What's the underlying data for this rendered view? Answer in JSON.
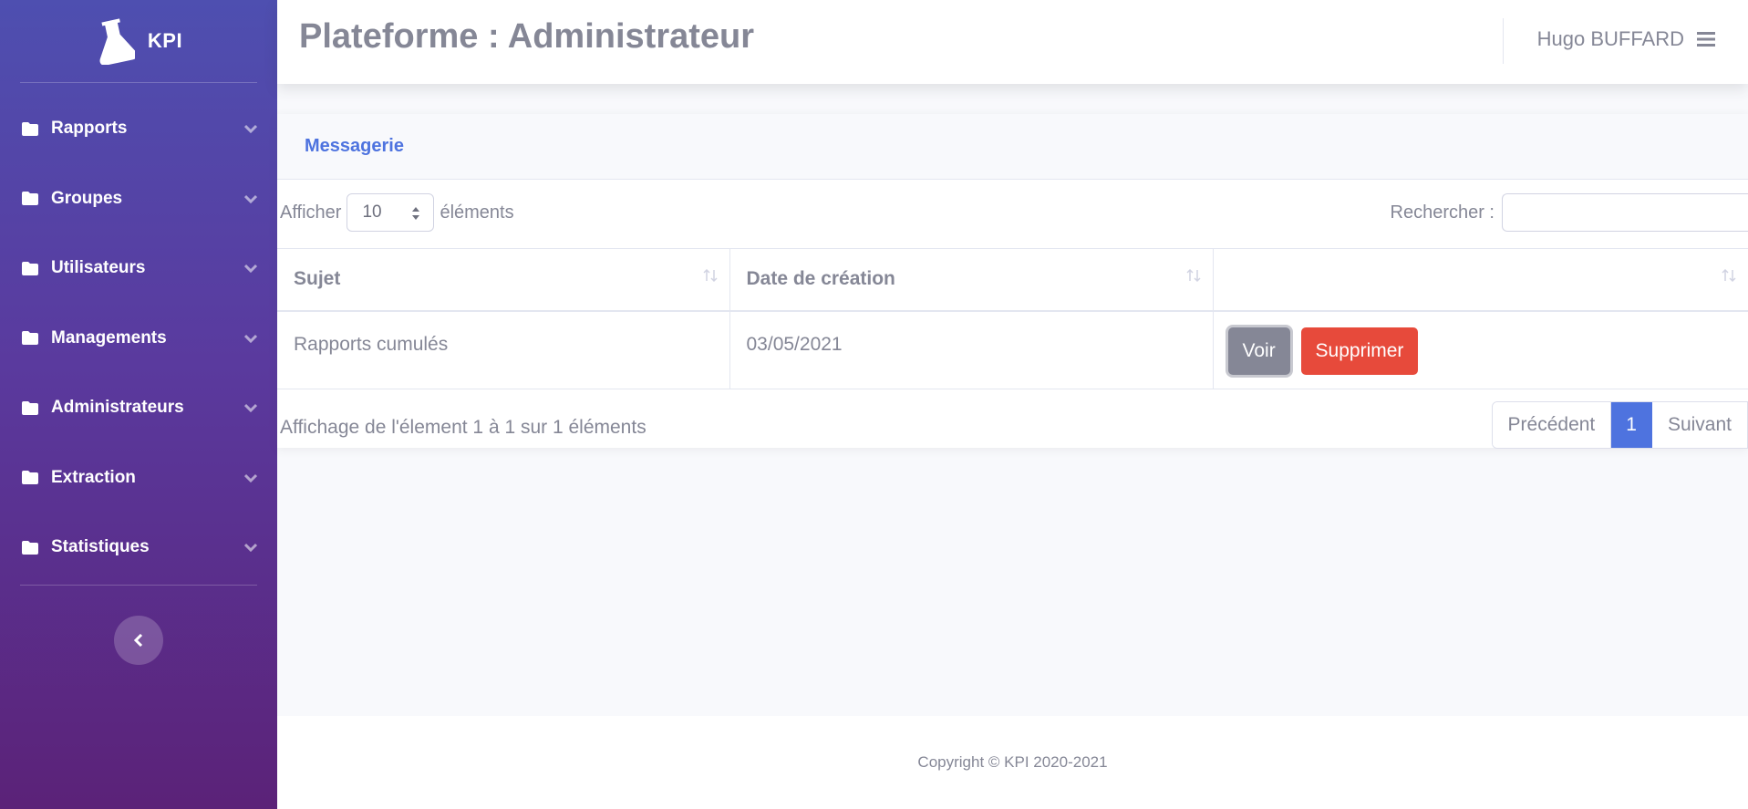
{
  "brand": {
    "name": "KPI",
    "icon": "flask-icon"
  },
  "sidebar": {
    "items": [
      {
        "label": "Rapports",
        "icon": "folder-icon"
      },
      {
        "label": "Groupes",
        "icon": "folder-icon"
      },
      {
        "label": "Utilisateurs",
        "icon": "folder-icon"
      },
      {
        "label": "Managements",
        "icon": "folder-icon"
      },
      {
        "label": "Administrateurs",
        "icon": "folder-icon"
      },
      {
        "label": "Extraction",
        "icon": "folder-icon"
      },
      {
        "label": "Statistiques",
        "icon": "folder-icon"
      }
    ],
    "toggle_icon": "chevron-left-icon",
    "gradient": [
      "#4e4fb0",
      "#5b2278"
    ]
  },
  "header": {
    "title_bold": "Plateforme :",
    "title_rest": "Administrateur",
    "user_name": "Hugo BUFFARD",
    "menu_icon": "hamburger-icon"
  },
  "card": {
    "title": "Messagerie",
    "length": {
      "prefix": "Afficher",
      "value": "10",
      "suffix": "éléments"
    },
    "search_label": "Rechercher :",
    "search_value": "",
    "columns": [
      "Sujet",
      "Date de création",
      ""
    ],
    "rows": [
      {
        "sujet": "Rapports cumulés",
        "date": "03/05/2021",
        "view_label": "Voir",
        "delete_label": "Supprimer"
      }
    ],
    "info": "Affichage de l'élement 1 à 1 sur 1 éléments",
    "pagination": {
      "prev": "Précédent",
      "current": "1",
      "next": "Suivant"
    }
  },
  "footer": {
    "copyright": "Copyright © KPI 2020-2021"
  },
  "colors": {
    "primary": "#4e73df",
    "danger": "#e74a3b",
    "secondary": "#858796"
  }
}
